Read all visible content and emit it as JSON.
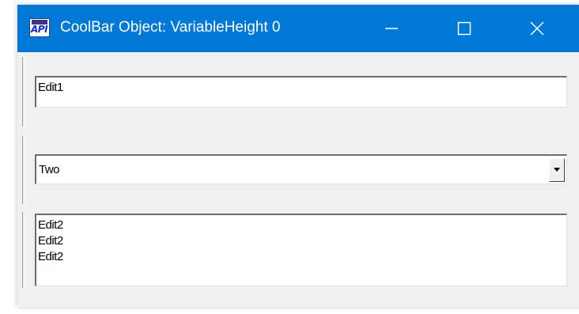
{
  "window": {
    "title": "CoolBar Object: VariableHeight 0",
    "controls": {
      "minimize": "minimize",
      "maximize": "maximize",
      "close": "close"
    }
  },
  "bands": {
    "edit1": {
      "value": "Edit1"
    },
    "combo": {
      "value": "Two"
    },
    "edit2": {
      "lines": [
        "Edit2",
        "Edit2",
        "Edit2"
      ]
    }
  },
  "colors": {
    "titlebar": "#0078d7",
    "window_bg": "#f0f0f0"
  },
  "icons": {
    "app": "api-app-icon",
    "minimize": "minimize-icon",
    "maximize": "maximize-icon",
    "close": "close-icon",
    "dropdown": "dropdown-arrow-icon"
  }
}
